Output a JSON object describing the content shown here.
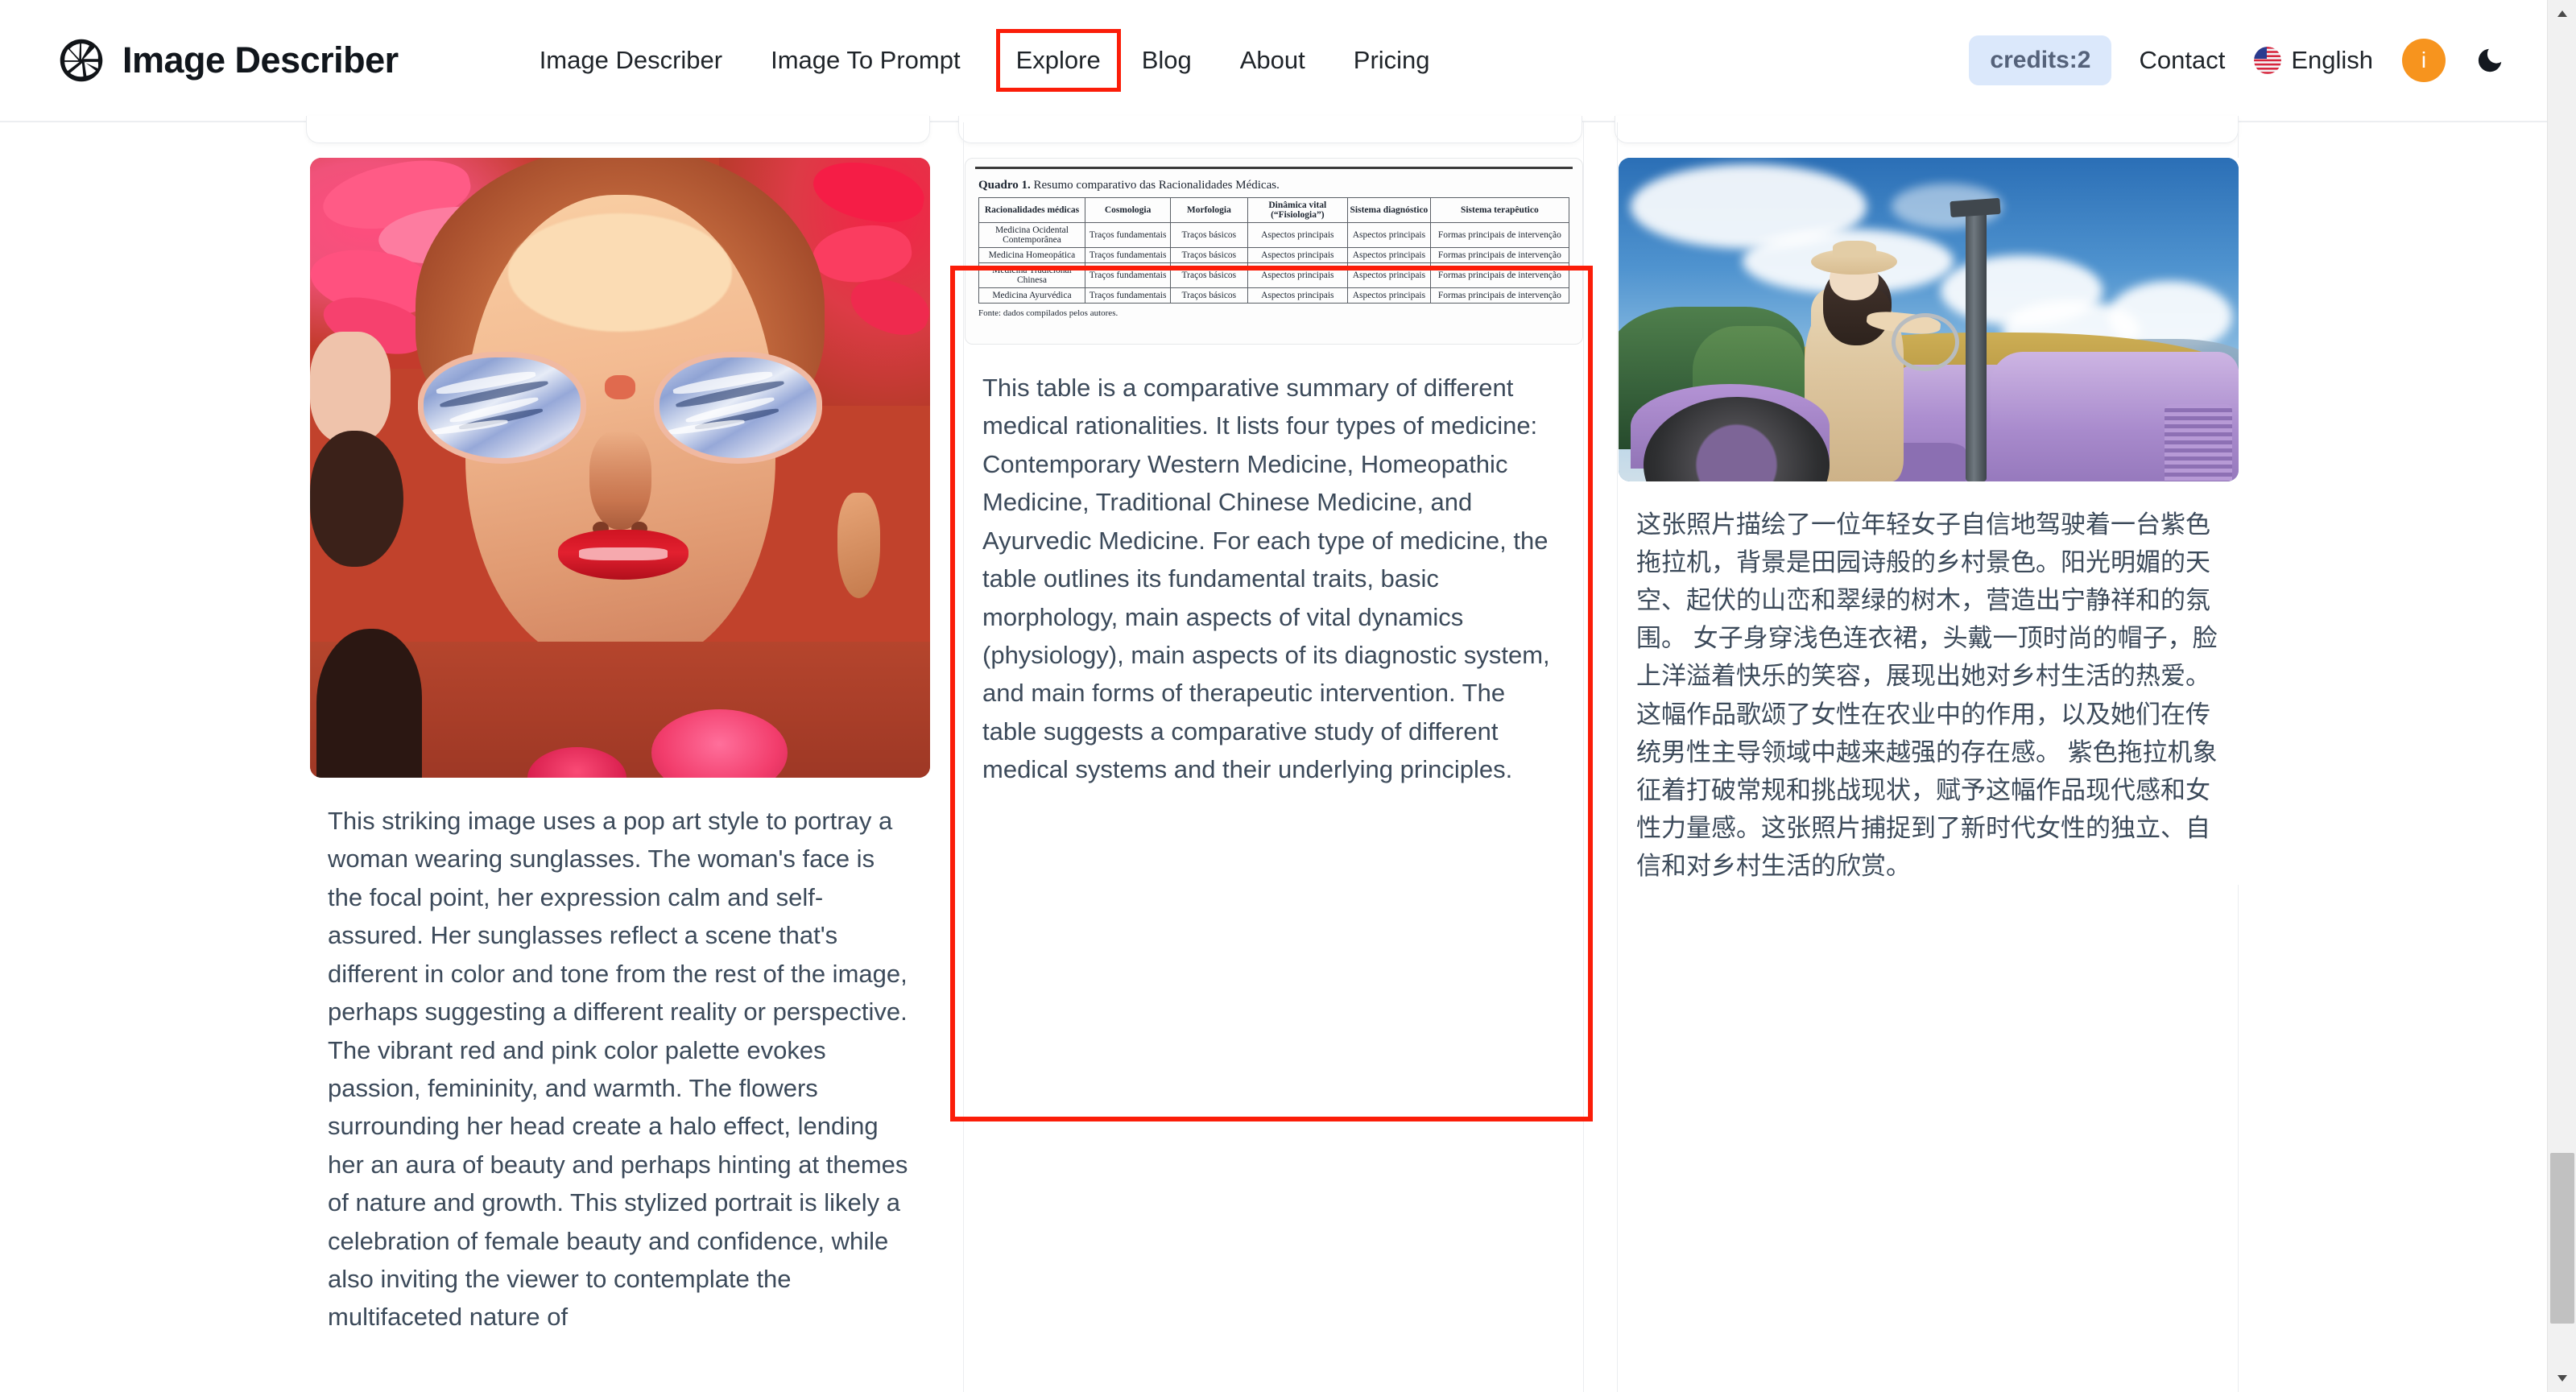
{
  "header": {
    "brand": {
      "name": "Image Describer",
      "logo_icon": "aperture-icon"
    },
    "nav": [
      {
        "label": "Image Describer",
        "highlighted": false
      },
      {
        "label": "Image To Prompt",
        "highlighted": false
      },
      {
        "label": "Explore",
        "highlighted": true
      },
      {
        "label": "Blog",
        "highlighted": false
      },
      {
        "label": "About",
        "highlighted": false
      },
      {
        "label": "Pricing",
        "highlighted": false
      }
    ],
    "credits_badge": "credits:2",
    "contact_label": "Contact",
    "language": {
      "label": "English",
      "flag_icon": "us-flag-icon"
    },
    "avatar_initial": "i",
    "theme_toggle_icon": "moon-icon",
    "accent_highlight_color": "#fb1d09",
    "credits_badge_bg": "#dbe8fb",
    "credits_badge_text_color": "#55627a",
    "avatar_bg": "#f7941e"
  },
  "gallery": {
    "cards": [
      {
        "id": "card-popart-woman",
        "thumbnail_alt": "Pop art style portrait of a woman wearing reflective sunglasses surrounded by pink flowers",
        "description": "This striking image uses a pop art style to portray a woman wearing sunglasses. The woman's face is the focal point, her expression calm and self-assured. Her sunglasses reflect a scene that's different in color and tone from the rest of the image, perhaps suggesting a different reality or perspective. The vibrant red and pink color palette evokes passion, femininity, and warmth. The flowers surrounding her head create a halo effect, lending her an aura of beauty and perhaps hinting at themes of nature and growth. This stylized portrait is likely a celebration of female beauty and confidence, while also inviting the viewer to contemplate the multifaceted nature of"
      },
      {
        "id": "card-medical-table",
        "highlighted": true,
        "thumbnail_alt": "Scanned academic table: Quadro 1 comparative summary of Medical Rationalities",
        "table": {
          "caption_bold": "Quadro 1.",
          "caption_rest": " Resumo comparativo das Racionalidades Médicas.",
          "headers": [
            "Racionalidades médicas",
            "Cosmologia",
            "Morfologia",
            "Dinâmica vital (“Fisiologia”)",
            "Sistema diagnóstico",
            "Sistema terapêutico"
          ],
          "rows": [
            [
              "Medicina Ocidental Contemporânea",
              "Traços fundamentais",
              "Traços básicos",
              "Aspectos principais",
              "Aspectos principais",
              "Formas principais de intervenção"
            ],
            [
              "Medicina Homeopática",
              "Traços fundamentais",
              "Traços básicos",
              "Aspectos principais",
              "Aspectos principais",
              "Formas principais de intervenção"
            ],
            [
              "Medicina Tradicional Chinesa",
              "Traços fundamentais",
              "Traços básicos",
              "Aspectos principais",
              "Aspectos principais",
              "Formas principais de intervenção"
            ],
            [
              "Medicina Ayurvédica",
              "Traços fundamentais",
              "Traços básicos",
              "Aspectos principais",
              "Aspectos principais",
              "Formas principais de intervenção"
            ]
          ],
          "source_note": "Fonte: dados compilados pelos autores."
        },
        "description": "This table is a comparative summary of different medical rationalities. It lists four types of medicine: Contemporary Western Medicine, Homeopathic Medicine, Traditional Chinese Medicine, and Ayurvedic Medicine. For each type of medicine, the table outlines its fundamental traits, basic morphology, main aspects of vital dynamics (physiology), main aspects of its diagnostic system, and main forms of therapeutic intervention. The table suggests a comparative study of different medical systems and their underlying principles."
      },
      {
        "id": "card-tractor-woman",
        "thumbnail_alt": "Young woman in a beige dress and straw hat driving a purple tractor in a rural landscape",
        "description": "这张照片描绘了一位年轻女子自信地驾驶着一台紫色拖拉机，背景是田园诗般的乡村景色。阳光明媚的天空、起伏的山峦和翠绿的树木，营造出宁静祥和的氛围。 女子身穿浅色连衣裙，头戴一顶时尚的帽子，脸上洋溢着快乐的笑容，展现出她对乡村生活的热爱。 这幅作品歌颂了女性在农业中的作用，以及她们在传统男性主导领域中越来越强的存在感。 紫色拖拉机象征着打破常规和挑战现状，赋予这幅作品现代感和女性力量感。这张照片捕捉到了新时代女性的独立、自信和对乡村生活的欣赏。"
      }
    ]
  },
  "scrollbar": {
    "up_arrow_icon": "chevron-up-icon",
    "down_arrow_icon": "chevron-down-icon"
  }
}
